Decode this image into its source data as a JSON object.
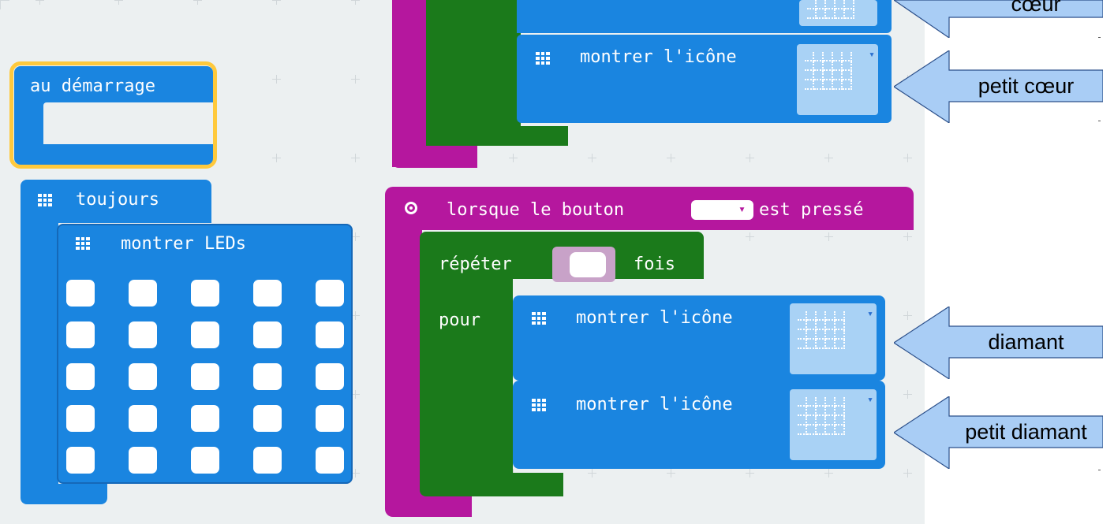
{
  "colors": {
    "workspace": "#ecf0f1",
    "basic_blue": "#1a85e0",
    "input_magenta": "#b5179e",
    "loop_green": "#1b7a1b",
    "highlight_yellow": "#ffc93c",
    "callout_fill": "#a9cdf5"
  },
  "blocks": {
    "on_start": {
      "label": "au démarrage"
    },
    "forever": {
      "label": "toujours",
      "show_leds": {
        "label": "montrer LEDs",
        "rows": 5,
        "cols": 5
      }
    },
    "top_group": {
      "show_icon_label": "montrer l'icône"
    },
    "on_button": {
      "label_before": "lorsque le bouton",
      "button_value": "",
      "label_after": "est pressé",
      "repeat": {
        "label": "répéter",
        "times_label": "fois",
        "do_label": "pour"
      },
      "show_icon_1": "montrer l'icône",
      "show_icon_2": "montrer l'icône"
    }
  },
  "callouts": {
    "top": "cœur",
    "small_heart": "petit cœur",
    "diamond": "diamant",
    "small_diamond": "petit diamant"
  },
  "icons": {
    "grid": "grid-icon",
    "button_event": "radio-target-icon",
    "dropdown": "chevron-down-icon"
  }
}
